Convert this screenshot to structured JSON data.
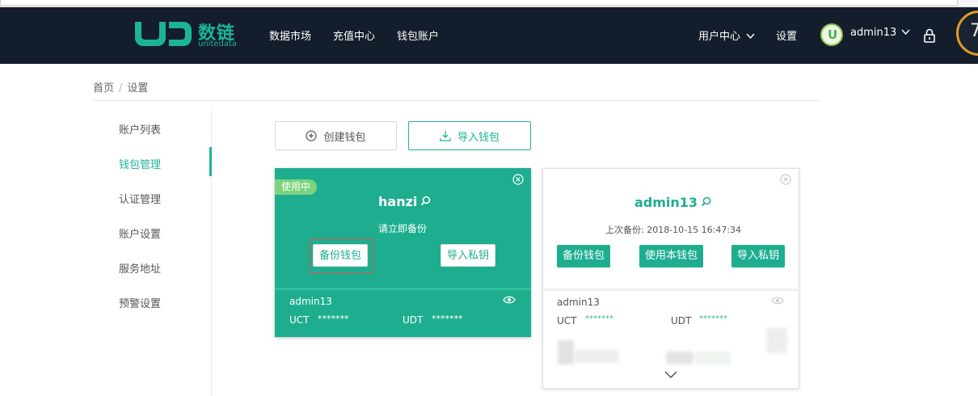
{
  "brand": {
    "name_cn": "数链",
    "name_en": "unitedata",
    "color": "#1bb594"
  },
  "nav": {
    "links": [
      "数据市场",
      "充值中心",
      "钱包账户"
    ],
    "user_center": "用户中心",
    "settings": "设置",
    "username": "admin13",
    "avatar_letter": "U",
    "badge_text": "7"
  },
  "breadcrumb": {
    "home": "首页",
    "separator": "/",
    "current": "设置"
  },
  "sidebar": {
    "items": [
      {
        "label": "账户列表",
        "active": false
      },
      {
        "label": "钱包管理",
        "active": true
      },
      {
        "label": "认证管理",
        "active": false
      },
      {
        "label": "账户设置",
        "active": false
      },
      {
        "label": "服务地址",
        "active": false
      },
      {
        "label": "预警设置",
        "active": false
      }
    ]
  },
  "actions": {
    "create_wallet": "创建钱包",
    "import_wallet": "导入钱包"
  },
  "wallets": [
    {
      "in_use_tag": "使用中",
      "name": "hanzi",
      "status_text": "请立即备份",
      "buttons": [
        "备份钱包",
        "导入私钥"
      ],
      "account": "admin13",
      "balances": [
        {
          "token": "UCT",
          "value": "*******"
        },
        {
          "token": "UDT",
          "value": "*******"
        }
      ]
    },
    {
      "name": "admin13",
      "status_text": "上次备份: 2018-10-15 16:47:34",
      "buttons": [
        "备份钱包",
        "使用本钱包",
        "导入私钥"
      ],
      "account": "admin13",
      "balances": [
        {
          "token": "UCT",
          "value": "*******"
        },
        {
          "token": "UDT",
          "value": "*******"
        }
      ]
    }
  ],
  "colors": {
    "nav_bg": "#141d2b",
    "accent": "#1bb594",
    "card_active": "#1eae8f",
    "highlight": "#d9534f"
  }
}
